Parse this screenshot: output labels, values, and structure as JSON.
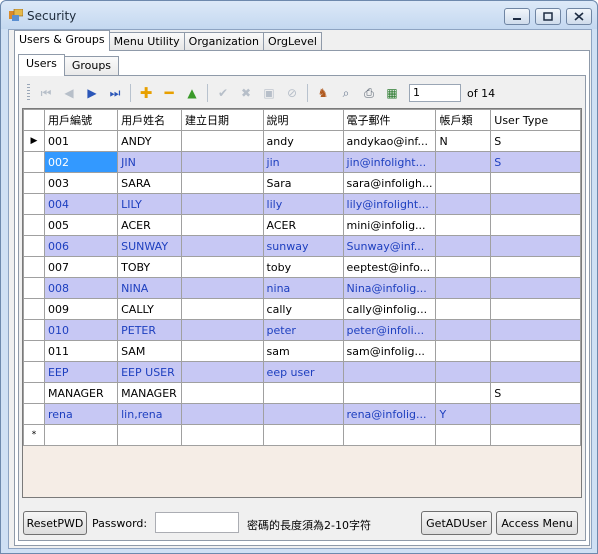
{
  "window": {
    "title": "Security",
    "min_icon": "minimize-icon",
    "max_icon": "maximize-icon",
    "close_icon": "close-icon"
  },
  "outer_tabs": [
    {
      "label": "Users & Groups"
    },
    {
      "label": "Menu Utility"
    },
    {
      "label": "Organization"
    },
    {
      "label": "OrgLevel"
    }
  ],
  "inner_tabs": [
    {
      "label": "Users"
    },
    {
      "label": "Groups"
    }
  ],
  "navigator": {
    "position": "1",
    "of_label": "of 14"
  },
  "grid": {
    "columns": [
      "用戶編號",
      "用戶姓名",
      "建立日期",
      "說明",
      "電子郵件",
      "帳戶類",
      "User Type"
    ],
    "rows": [
      [
        "001",
        "ANDY",
        "",
        "andy",
        "andykao@inf...",
        "N",
        "S"
      ],
      [
        "002",
        "JIN",
        "",
        "jin",
        "jin@infolight...",
        "",
        "S"
      ],
      [
        "003",
        "SARA",
        "",
        "Sara",
        "sara@infoligh...",
        "",
        ""
      ],
      [
        "004",
        "LILY",
        "",
        "lily",
        "lily@infolight...",
        "",
        ""
      ],
      [
        "005",
        "ACER",
        "",
        "ACER",
        "mini@infolig...",
        "",
        ""
      ],
      [
        "006",
        "SUNWAY",
        "",
        "sunway",
        "Sunway@inf...",
        "",
        ""
      ],
      [
        "007",
        "TOBY",
        "",
        "toby",
        "eeptest@info...",
        "",
        ""
      ],
      [
        "008",
        "NINA",
        "",
        "nina",
        "Nina@infolig...",
        "",
        ""
      ],
      [
        "009",
        "CALLY",
        "",
        "cally",
        "cally@infolig...",
        "",
        ""
      ],
      [
        "010",
        "PETER",
        "",
        "peter",
        "peter@infoli...",
        "",
        ""
      ],
      [
        "011",
        "SAM",
        "",
        "sam",
        "sam@infolig...",
        "",
        ""
      ],
      [
        "EEP",
        "EEP USER",
        "",
        "eep user",
        "",
        "",
        ""
      ],
      [
        "MANAGER",
        "MANAGER",
        "",
        "",
        "",
        "",
        "S"
      ],
      [
        "rena",
        "lin,rena",
        "",
        "",
        "rena@infolig...",
        "Y",
        ""
      ]
    ],
    "current_row_marker": "▶",
    "new_row_marker": "*"
  },
  "footer": {
    "reset_pwd": "ResetPWD",
    "password_label": "Password:",
    "password_value": "",
    "hint": "密碼的長度須為2-10字符",
    "get_ad_user": "GetADUser",
    "access_menu": "Access Menu"
  }
}
